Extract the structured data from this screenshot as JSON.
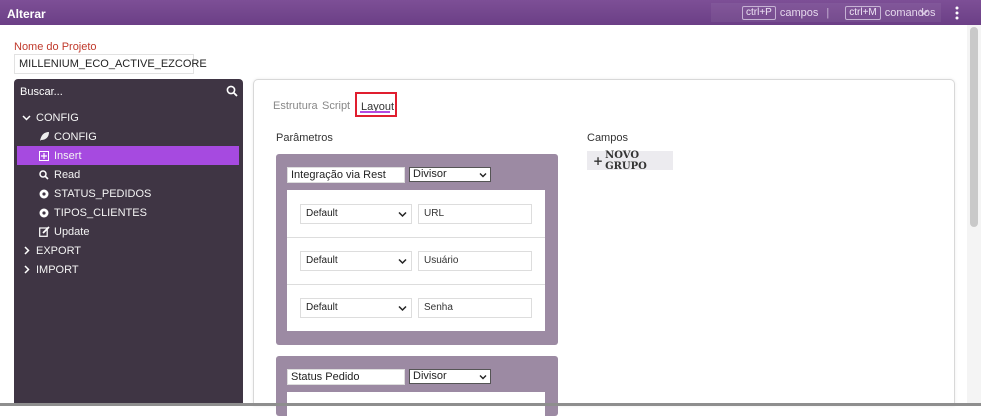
{
  "window": {
    "title": "Alterar"
  },
  "command_bar": {
    "shortcut1": "ctrl+P",
    "shortcut1_label": "campos",
    "separator": "|",
    "shortcut2": "ctrl+M",
    "shortcut2_label": "comandos"
  },
  "project": {
    "label": "Nome do Projeto",
    "value": "MILLENIUM_ECO_ACTIVE_EZCORE"
  },
  "sidebar": {
    "search_placeholder": "Buscar...",
    "tree": [
      {
        "label": "CONFIG",
        "expanded": true,
        "icon": "chevron-down-icon",
        "children": [
          {
            "label": "CONFIG",
            "icon": "leaf-icon"
          },
          {
            "label": "Insert",
            "icon": "plus-square-icon",
            "selected": true
          },
          {
            "label": "Read",
            "icon": "search-icon"
          },
          {
            "label": "STATUS_PEDIDOS",
            "icon": "gear-icon"
          },
          {
            "label": "TIPOS_CLIENTES",
            "icon": "gear-icon"
          },
          {
            "label": "Update",
            "icon": "edit-icon"
          }
        ]
      },
      {
        "label": "EXPORT",
        "expanded": false,
        "icon": "chevron-right-icon"
      },
      {
        "label": "IMPORT",
        "expanded": false,
        "icon": "chevron-right-icon"
      }
    ]
  },
  "tabs": [
    {
      "label": "Estrutura",
      "active": false
    },
    {
      "label": "Script",
      "active": false
    },
    {
      "label": "Layout",
      "active": true
    }
  ],
  "parametros": {
    "title": "Parâmetros",
    "groups": [
      {
        "name": "Integração via Rest",
        "type": "Divisor",
        "fields": [
          {
            "mode": "Default",
            "value": "URL"
          },
          {
            "mode": "Default",
            "value": "Usuário"
          },
          {
            "mode": "Default",
            "value": "Senha"
          }
        ]
      },
      {
        "name": "Status Pedido",
        "type": "Divisor",
        "fields": []
      }
    ]
  },
  "campos": {
    "title": "Campos",
    "new_group_label": "NOVO GRUPO"
  },
  "colors": {
    "topbar": "#6b3f86",
    "sidebar": "#3f3544",
    "selected": "#a64ae0",
    "group_box": "#9c8aa3",
    "highlight": "#e01e2f"
  }
}
